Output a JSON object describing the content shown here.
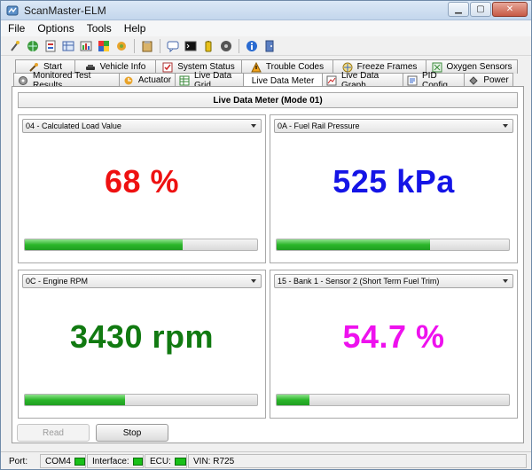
{
  "window": {
    "title": "ScanMaster-ELM"
  },
  "menu": [
    "File",
    "Options",
    "Tools",
    "Help"
  ],
  "toolbar_icons": [
    "new-icon",
    "connect-icon",
    "open-icon",
    "report-icon",
    "print-icon",
    "chart-icon",
    "settings-icon",
    "paste-icon",
    "chat-icon",
    "terminal-icon",
    "battery-icon",
    "disc-icon",
    "info-icon",
    "exit-icon"
  ],
  "tabs_row1": [
    {
      "label": "Start",
      "icon": "wrench-icon"
    },
    {
      "label": "Vehicle Info",
      "icon": "car-icon"
    },
    {
      "label": "System Status",
      "icon": "check-icon"
    },
    {
      "label": "Trouble Codes",
      "icon": "warning-icon"
    },
    {
      "label": "Freeze Frames",
      "icon": "snowflake-icon"
    },
    {
      "label": "Oxygen Sensors",
      "icon": "sensor-icon"
    }
  ],
  "tabs_row2": [
    {
      "label": "Monitored Test Results",
      "icon": "gear-icon"
    },
    {
      "label": "Actuator",
      "icon": "actuator-icon"
    },
    {
      "label": "Live Data Grid",
      "icon": "grid-icon"
    },
    {
      "label": "Live Data Meter",
      "icon": "",
      "active": true
    },
    {
      "label": "Live Data Graph",
      "icon": "graph-icon"
    },
    {
      "label": "PID Config",
      "icon": "config-icon"
    },
    {
      "label": "Power",
      "icon": "power-icon"
    }
  ],
  "meter_panel": {
    "title": "Live Data Meter (Mode 01)"
  },
  "meters": [
    {
      "pid": "04 - Calculated Load Value",
      "value": "68 %",
      "color": "#ee1111",
      "level": 0.68
    },
    {
      "pid": "0A - Fuel Rail Pressure",
      "value": "525 kPa",
      "color": "#1414e6",
      "level": 0.66
    },
    {
      "pid": "0C - Engine RPM",
      "value": "3430 rpm",
      "color": "#117a11",
      "level": 0.43
    },
    {
      "pid": "15 - Bank 1 - Sensor 2 (Short Term Fuel Trim)",
      "value": "54.7 %",
      "color": "#ee11ee",
      "level": 0.14
    }
  ],
  "buttons": {
    "read": "Read",
    "stop": "Stop"
  },
  "status": {
    "port_label": "Port:",
    "port_value": "COM4",
    "interface_label": "Interface:",
    "ecu_label": "ECU:",
    "vin_label": "VIN: R725",
    "led_color": "#19c019"
  }
}
